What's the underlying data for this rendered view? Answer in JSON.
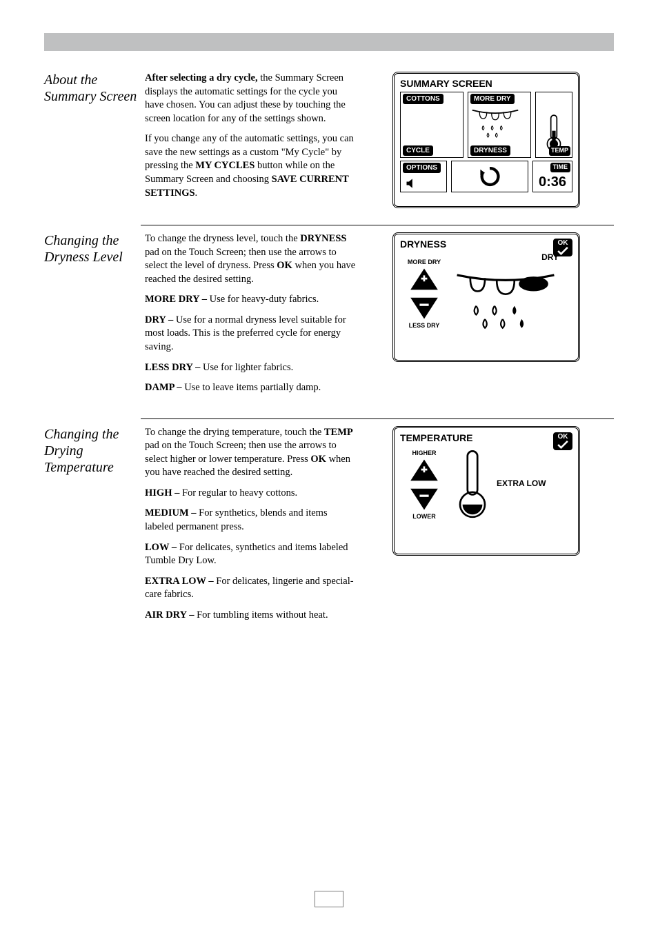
{
  "sections": {
    "summary": {
      "title": "About the Summary Screen",
      "p1_lead": "After selecting a dry cycle,",
      "p1_rest": " the Summary Screen displays the automatic settings for the cycle you have chosen. You can adjust these by touching the screen location for any of the settings shown.",
      "p2a": "If you change any of the automatic settings, you can save the new settings as a custom \"My Cycle\" by pressing the ",
      "p2_bold1": "MY CYCLES",
      "p2b": " button while on the Summary Screen and choosing ",
      "p2_bold2": "SAVE CURRENT SETTINGS",
      "p2c": "."
    },
    "dryness": {
      "title": "Changing the Dryness Level",
      "p1a": "To change the dryness level, touch the ",
      "p1_bold1": "DRYNESS",
      "p1b": " pad on the Touch Screen; then use the arrows to select the level of dryness. Press ",
      "p1_bold2": "OK",
      "p1c": " when you have reached the desired setting.",
      "items": {
        "more_dry_b": "MORE DRY –",
        "more_dry_t": " Use for heavy-duty fabrics.",
        "dry_b": "DRY –",
        "dry_t": " Use for a normal dryness level suitable for most loads. This is the preferred cycle for energy saving.",
        "less_dry_b": "LESS DRY –",
        "less_dry_t": " Use for lighter fabrics.",
        "damp_b": "DAMP –",
        "damp_t": " Use to leave items partially damp."
      }
    },
    "temp": {
      "title": "Changing the Drying Temperature",
      "p1a": "To change the drying temperature, touch the ",
      "p1_bold1": "TEMP",
      "p1b": " pad on the Touch Screen; then use the arrows to select higher or lower temperature. Press ",
      "p1_bold2": "OK",
      "p1c": " when you have reached the desired setting.",
      "items": {
        "high_b": "HIGH –",
        "high_t": " For regular to heavy cottons.",
        "medium_b": "MEDIUM –",
        "medium_t": " For synthetics, blends and items labeled permanent press.",
        "low_b": "LOW –",
        "low_t": " For delicates, synthetics and items labeled Tumble Dry Low.",
        "extra_low_b": "EXTRA LOW –",
        "extra_low_t": " For delicates, lingerie and special-care fabrics.",
        "air_dry_b": "AIR DRY –",
        "air_dry_t": " For tumbling items without heat."
      }
    }
  },
  "screens": {
    "summary": {
      "title": "SUMMARY SCREEN",
      "cottons": "COTTONS",
      "more_dry": "MORE DRY",
      "cycle": "CYCLE",
      "dryness": "DRYNESS",
      "options": "OPTIONS",
      "temp": "TEMP",
      "time": "TIME",
      "time_val": "0:36"
    },
    "dryness": {
      "title": "DRYNESS",
      "ok": "OK",
      "more_dry": "MORE DRY",
      "less_dry": "LESS DRY",
      "value": "DRY"
    },
    "temp": {
      "title": "TEMPERATURE",
      "ok": "OK",
      "higher": "HIGHER",
      "lower": "LOWER",
      "value": "EXTRA LOW"
    }
  }
}
